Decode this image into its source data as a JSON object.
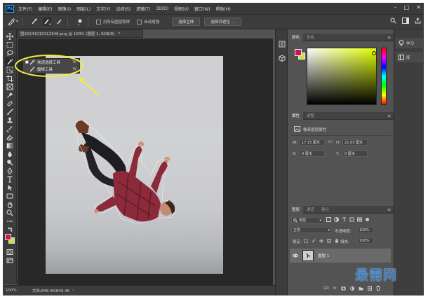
{
  "menubar": {
    "logo": "Ps",
    "items": [
      "文件(F)",
      "编辑(E)",
      "图像(I)",
      "图层(L)",
      "文字(Y)",
      "选择(S)",
      "滤镜(T)",
      "3D(D)",
      "视图(V)",
      "窗口(W)",
      "帮助(H)"
    ],
    "controls": [
      "–",
      "□",
      "✕"
    ]
  },
  "options_bar": {
    "sample_all_layers": "对所有图层取样",
    "auto_enhance": "自动增强",
    "select_subject": "选择主体",
    "select_and_mask": "选择并遮住 ..."
  },
  "document_tab": {
    "title": "图20241015112346.png @ 100% (图层 1, RGB/8)",
    "close": "×"
  },
  "tool_popup": {
    "items": [
      {
        "label": "快速选择工具",
        "key": "W"
      },
      {
        "label": "魔棒工具",
        "key": "W"
      }
    ]
  },
  "status_bar": {
    "zoom": "100%",
    "doc": "文档:849.4K/849.4K",
    "arrow": "›"
  },
  "color_panel": {
    "tabs": [
      "颜色",
      "色板"
    ],
    "foreground": "#c8145a",
    "background": "#c8e632",
    "picker_hue": "#dfff00"
  },
  "properties_panel": {
    "tabs": [
      "属性",
      "调整"
    ],
    "section": "像素图层属性",
    "w_label": "W:",
    "w_value": "17.15 厘米",
    "h_label": "H:",
    "h_value": "21.03 厘米",
    "x_label": "X:",
    "x_value": "0 厘米",
    "y_label": "Y:",
    "y_value": "0 厘米",
    "link": "GO"
  },
  "layers_panel": {
    "tabs": [
      "图层",
      "通道",
      "路径"
    ],
    "filter": "类型",
    "blend_mode": "正常",
    "opacity_label": "不透明度:",
    "opacity": "100%",
    "lock_label": "锁定:",
    "fill_label": "填充:",
    "fill": "100%",
    "layers": [
      {
        "name": "图层 1"
      }
    ],
    "footer_icons": [
      "GO",
      "fx"
    ]
  },
  "side_strip": {
    "learn": "学习",
    "library": "库"
  },
  "watermark": "最需网"
}
